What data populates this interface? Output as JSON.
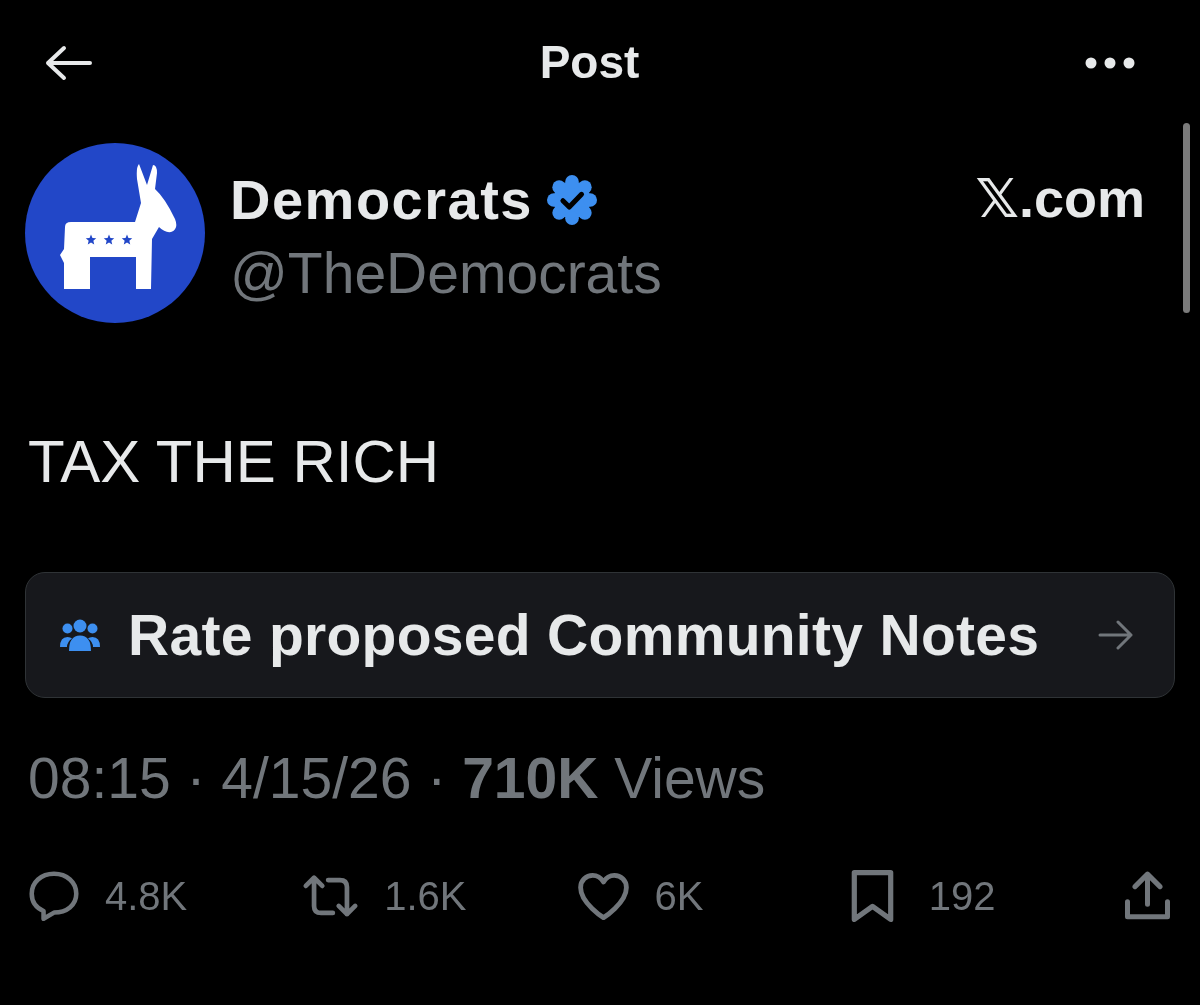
{
  "header": {
    "title": "Post"
  },
  "post": {
    "author": {
      "name": "Democrats",
      "verified": true,
      "handle": "@TheDemocrats"
    },
    "source": "𝕏.com",
    "text": "TAX THE RICH",
    "community_notes": {
      "label": "Rate proposed Community Notes"
    },
    "meta": "08:15 · 4/15/26 · **710K** Views",
    "actions": [
      {
        "kind": "reply",
        "count": "4.8K"
      },
      {
        "kind": "repost",
        "count": "1.6K"
      },
      {
        "kind": "like",
        "count": "6K"
      },
      {
        "kind": "bookmark",
        "count": "192"
      },
      {
        "kind": "share"
      }
    ]
  }
}
